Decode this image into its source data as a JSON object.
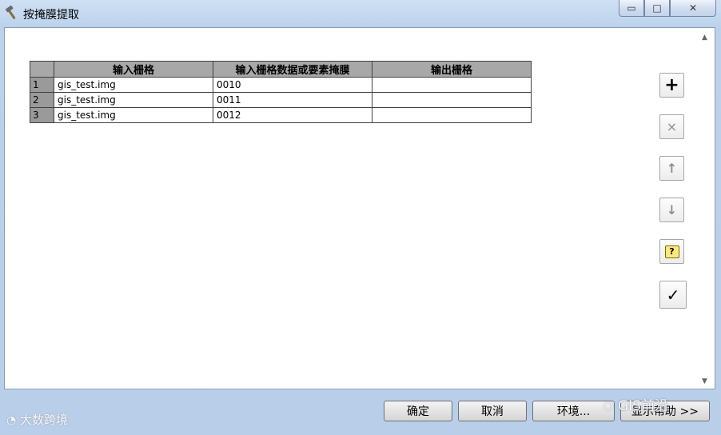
{
  "window": {
    "title": "按掩膜提取",
    "icon": "hammer-icon"
  },
  "window_controls": {
    "minimize": "▭",
    "maximize": "□",
    "close": "✕"
  },
  "grid": {
    "columns": [
      "输入栅格",
      "输入栅格数据或要素掩膜",
      "输出栅格"
    ],
    "rows": [
      {
        "num": "1",
        "input": "gis_test.img",
        "mask": "0010",
        "output": ""
      },
      {
        "num": "2",
        "input": "gis_test.img",
        "mask": "0011",
        "output": ""
      },
      {
        "num": "3",
        "input": "gis_test.img",
        "mask": "0012",
        "output": ""
      }
    ]
  },
  "side_buttons": {
    "add": "+",
    "delete": "×",
    "up": "↑",
    "down": "↓",
    "help": "?",
    "check": "✓"
  },
  "scroll": {
    "up": "▲",
    "down": "▼"
  },
  "footer": {
    "ok": "确定",
    "cancel": "取消",
    "environments": "环境...",
    "show_help": "显示帮助 >>"
  },
  "watermarks": {
    "left": "大数跨境",
    "right": "GIS前沿"
  }
}
